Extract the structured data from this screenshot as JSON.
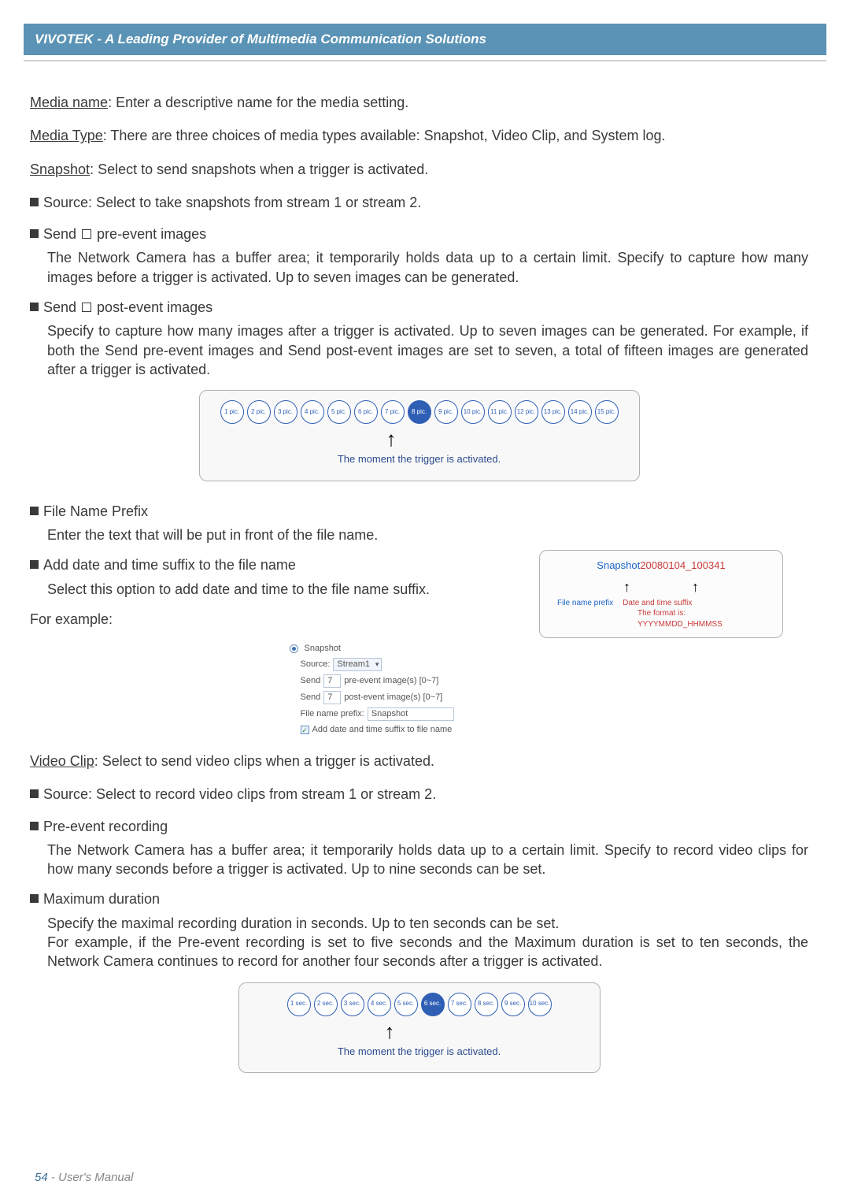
{
  "header": {
    "title": "VIVOTEK - A Leading Provider of Multimedia Communication Solutions"
  },
  "text": {
    "media_name": "Media name",
    "media_name_desc": ": Enter a descriptive name for the media setting.",
    "media_type": "Media Type",
    "media_type_desc": ": There are three choices of media types available: Snapshot, Video Clip, and System log.",
    "snapshot": "Snapshot",
    "snapshot_desc": ": Select to send snapshots when a trigger is activated.",
    "src_snap": "Source: Select to take snapshots from stream 1 or stream 2.",
    "send_pre_a": "Send ",
    "send_pre_b": " pre-event images",
    "send_pre_body": "The Network Camera has a buffer area; it temporarily holds data up to a certain limit. Specify to capture how many images before a trigger is activated. Up to seven images can be generated.",
    "send_post_a": "Send ",
    "send_post_b": " post-event images",
    "send_post_body": "Specify to capture how many images after a trigger is activated. Up to seven images can be generated. For example, if both the Send pre-event images and Send post-event images are set to seven, a total of fifteen images are generated after a trigger is activated.",
    "trigger_caption": "The moment the trigger is activated.",
    "file_prefix_t": "File Name Prefix",
    "file_prefix_b": "Enter the text that will be put in front of the file name.",
    "datetime_t": "Add date and time suffix to the file name",
    "datetime_b": "Select this option to add date and time to the file name suffix.",
    "for_example": "For example:",
    "video_clip": "Video Clip",
    "video_clip_desc": ": Select to send video clips when a trigger is activated.",
    "src_vid": "Source: Select to record video clips from stream 1 or stream 2.",
    "pre_rec_t": "Pre-event recording",
    "pre_rec_b": "The Network Camera has a buffer area; it temporarily holds data up to a certain limit. Specify to record video clips for how many seconds before a trigger is activated. Up to nine seconds can be set.",
    "max_dur_t": "Maximum duration",
    "max_dur_b": "Specify the maximal recording duration in seconds. Up to ten seconds can be set.\nFor example, if the Pre-event recording is set to five seconds and the Maximum duration is set to ten seconds, the Network Camera continues to record for another four seconds after a trigger is activated."
  },
  "chart_data": [
    {
      "type": "pic_sequence",
      "labels": [
        "1 pic.",
        "2 pic.",
        "3 pic.",
        "4 pic.",
        "5 pic.",
        "6 pic.",
        "7 pic.",
        "8 pic.",
        "9 pic.",
        "10 pic.",
        "11 pic.",
        "12 pic.",
        "13 pic.",
        "14 pic.",
        "15 pic."
      ],
      "highlight_index": 7,
      "caption": "The moment the trigger is activated."
    },
    {
      "type": "sec_sequence",
      "labels": [
        "1 sec.",
        "2 sec.",
        "3 sec.",
        "4 sec.",
        "5 sec.",
        "6 sec.",
        "7 sec.",
        "8 sec.",
        "9 sec.",
        "10 sec."
      ],
      "highlight_index": 5,
      "caption": "The moment the trigger is activated."
    }
  ],
  "file_box": {
    "prefix": "Snapshot",
    "suffix": "20080104_100341",
    "label1": "File name prefix",
    "label2": "Date and time suffix",
    "format": "The format is: YYYYMMDD_HHMMSS"
  },
  "snapshot_ui": {
    "radio_label": "Snapshot",
    "source_label": "Source:",
    "source_value": "Stream1",
    "send_label": "Send",
    "pre_value": "7",
    "pre_suffix": "pre-event image(s) [0~7]",
    "post_value": "7",
    "post_suffix": "post-event image(s) [0~7]",
    "prefix_label": "File name prefix:",
    "prefix_value": "Snapshot",
    "add_dt_label": "Add date and time suffix to file name"
  },
  "footer": {
    "page": "54",
    "sep": " - ",
    "label": "User's Manual"
  }
}
